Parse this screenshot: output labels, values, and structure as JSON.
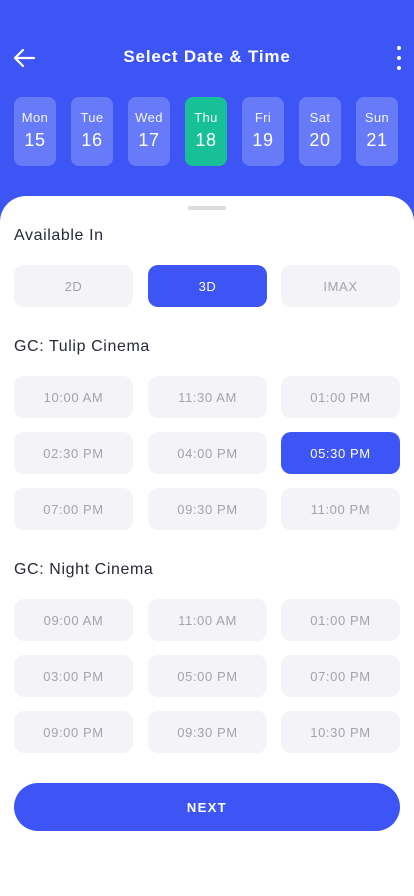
{
  "header": {
    "title": "Select Date & Time"
  },
  "days": [
    {
      "name": "Mon",
      "num": "15"
    },
    {
      "name": "Tue",
      "num": "16"
    },
    {
      "name": "Wed",
      "num": "17"
    },
    {
      "name": "Thu",
      "num": "18",
      "active": true
    },
    {
      "name": "Fri",
      "num": "19"
    },
    {
      "name": "Sat",
      "num": "20"
    },
    {
      "name": "Sun",
      "num": "21"
    }
  ],
  "formats": {
    "title": "Available In",
    "options": [
      "2D",
      "3D",
      "IMAX"
    ],
    "selected": "3D"
  },
  "cinemas": [
    {
      "name": "GC: Tulip Cinema",
      "times": [
        "10:00 AM",
        "11:30 AM",
        "01:00 PM",
        "02:30 PM",
        "04:00 PM",
        "05:30 PM",
        "07:00 PM",
        "09:30 PM",
        "11:00 PM"
      ],
      "selected": "05:30 PM"
    },
    {
      "name": "GC: Night Cinema",
      "times": [
        "09:00 AM",
        "11:00 AM",
        "01:00 PM",
        "03:00 PM",
        "05:00 PM",
        "07:00 PM",
        "09:00 PM",
        "09:30 PM",
        "10:30 PM"
      ],
      "selected": null
    }
  ],
  "next_label": "NEXT",
  "colors": {
    "primary": "#3d55f5",
    "accent": "#17c097",
    "chip_bg": "#f4f3f8",
    "chip_text": "#a3a3ad"
  },
  "icons": {
    "back": "arrow-left-icon",
    "more": "more-vertical-icon"
  }
}
